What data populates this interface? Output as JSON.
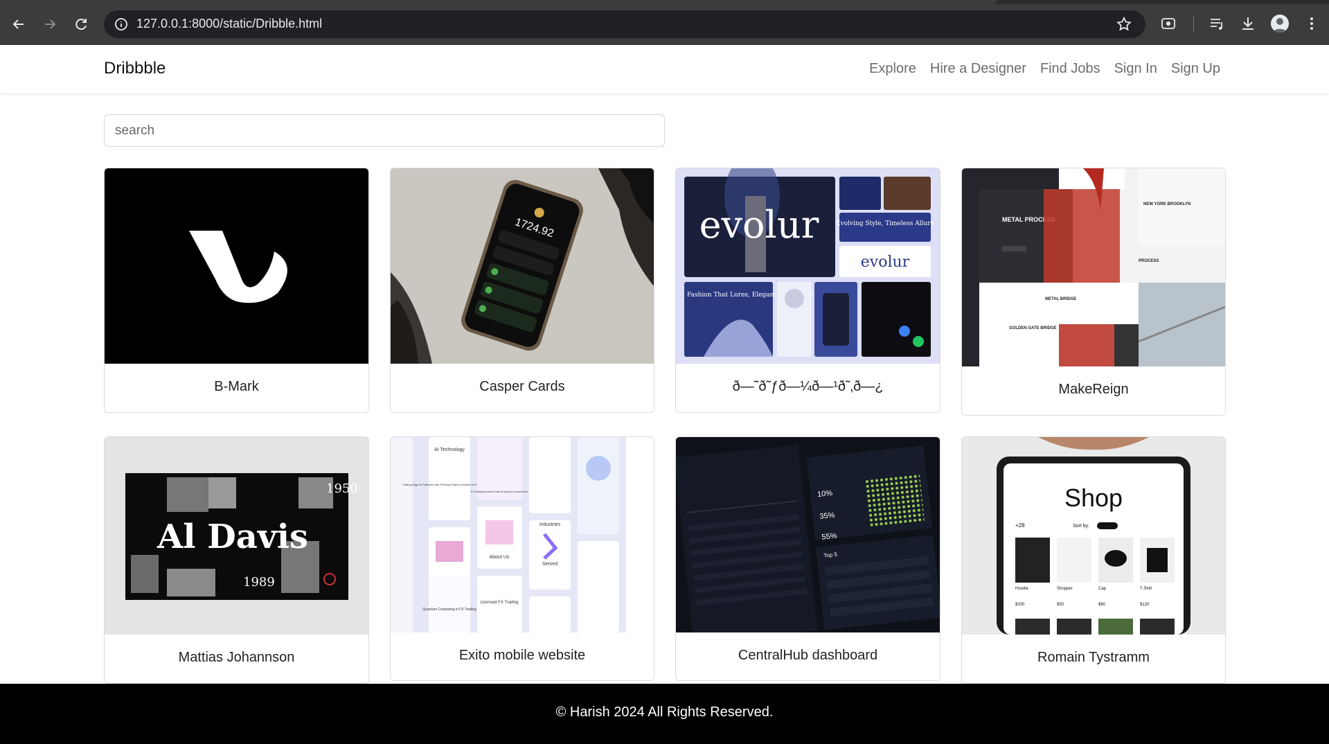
{
  "browser": {
    "url": "127.0.0.1:8000/static/Dribble.html"
  },
  "navbar": {
    "brand": "Dribbble",
    "links": [
      "Explore",
      "Hire a Designer",
      "Find Jobs",
      "Sign In",
      "Sign Up"
    ]
  },
  "search": {
    "placeholder": "search"
  },
  "cards": [
    {
      "title": "B-Mark"
    },
    {
      "title": "Casper Cards"
    },
    {
      "title": "ð—˜ð˜ƒð—¼ð—¹ð˜‚ð—¿"
    },
    {
      "title": "MakeReign"
    },
    {
      "title": "Mattias Johannson"
    },
    {
      "title": "Exito mobile website"
    },
    {
      "title": "CentralHub dashboard"
    },
    {
      "title": "Romain Tystramm"
    }
  ],
  "artwork_text": {
    "evolur_logo": "evolur",
    "evolur_tagline": "Evolving Style, Timeless Allure",
    "evolur_fashion": "Fashion That Lures, Elegance That Endures",
    "makereign_heading": "METAL PROCESS",
    "makereign_city": "NEW YORK BROOKLYN",
    "makereign_bridge": "METAL BRIDGE",
    "makereign_gg": "GOLDEN GATE BRIDGE",
    "makereign_process": "PROCESS",
    "aldavis_title": "Al Davis",
    "aldavis_year1": "1950",
    "aldavis_year2": "1989",
    "casper_balance": "1724.92",
    "exito_1": "AI Technology",
    "exito_2": "Cutting-Edge AI Software with Pending Patent Unveiled for Financial Traders",
    "exito_3": "FX trading boosted with AI and pro experience",
    "exito_4": "About Us",
    "exito_5": "Industries",
    "exito_6": "Served",
    "exito_7": "Licensed FX Trading",
    "exito_8": "Quantum Computing in FX Trading",
    "central_pct1": "10%",
    "central_pct2": "35%",
    "central_pct3": "55%",
    "central_top": "Top 5",
    "romain_shop": "Shop",
    "romain_sort": "Sort by:",
    "romain_items": [
      "Hoodie",
      "Shopper",
      "Cap",
      "T-Shirt"
    ],
    "romain_prices": [
      "$200",
      "$50",
      "$60",
      "$120"
    ],
    "romain_count": "+28"
  },
  "footer": {
    "copyright": "© Harish 2024 All Rights Reserved."
  },
  "colors": {
    "chrome_bg": "#3c3c3c",
    "omnibox_bg": "#202124",
    "footer_bg": "#000000",
    "nav_link": "#6b6b6b"
  }
}
